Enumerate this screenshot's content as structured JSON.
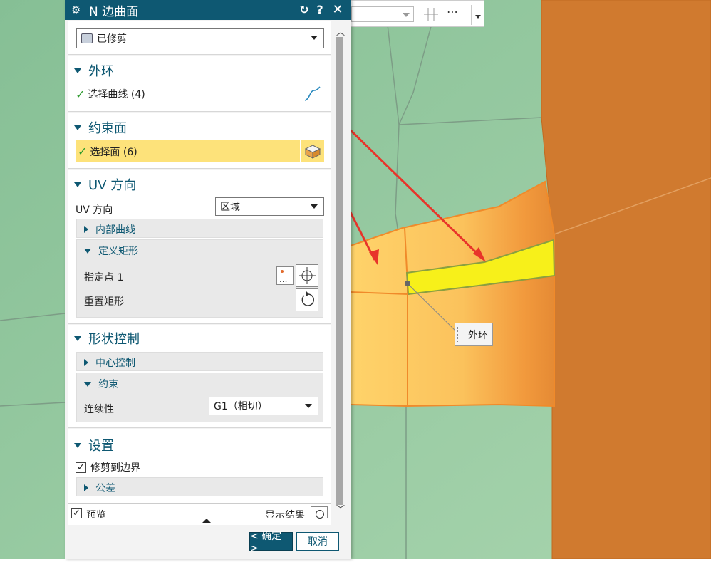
{
  "colors": {
    "accent": "#0e5872",
    "highlight": "#fde27a",
    "surface_orange": "#f7b257",
    "surface_yellow": "#f7f01a",
    "dark_orange": "#d07a2f",
    "green_bg": "#8fc59a",
    "red_arrow": "#e8342a"
  },
  "dialog": {
    "title": "N 边曲面",
    "icons": [
      "gear-icon",
      "reset-icon",
      "help-icon",
      "close-icon"
    ],
    "type_dropdown": {
      "value": "已修剪"
    },
    "outer_loop": {
      "header": "外环",
      "select_curve_label": "选择曲线 (4)"
    },
    "constraint_face": {
      "header": "约束面",
      "select_face_label": "选择面 (6)"
    },
    "uv_direction": {
      "header": "UV 方向",
      "uv_label": "UV 方向",
      "uv_value": "区域",
      "inner_curves_label": "内部曲线",
      "define_rect_label": "定义矩形",
      "specify_point_label": "指定点 1",
      "reset_rect_label": "重置矩形"
    },
    "shape_control": {
      "header": "形状控制",
      "center_control_label": "中心控制",
      "constraint_label": "约束",
      "continuity_label": "连续性",
      "continuity_value": "G1（相切）"
    },
    "settings": {
      "header": "设置",
      "trim_to_boundary_label": "修剪到边界",
      "tolerance_label": "公差"
    },
    "bottom": {
      "preview_label": "预览",
      "show_result_label": "显示结果"
    },
    "ok_label": "< 确定 >",
    "cancel_label": "取消"
  },
  "viewport": {
    "callout_label": "外环"
  }
}
